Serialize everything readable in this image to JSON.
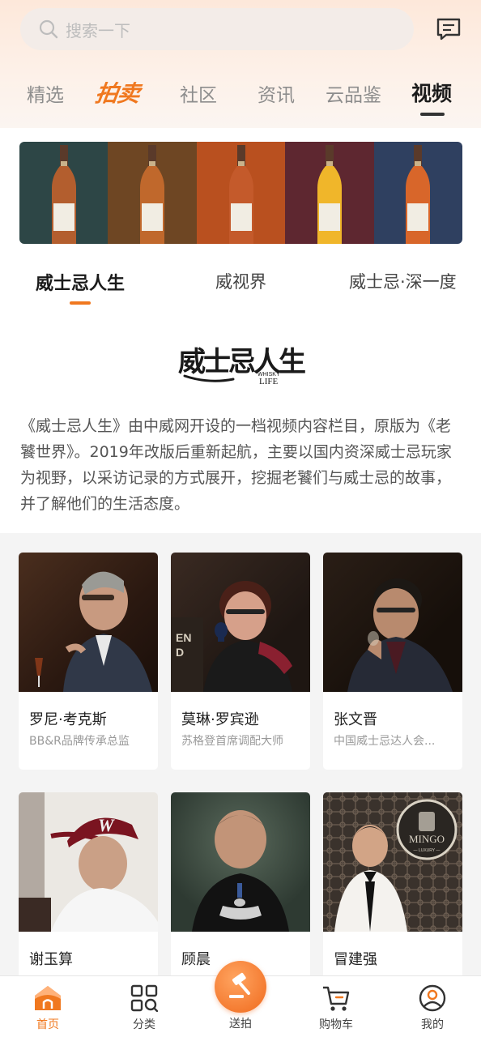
{
  "search": {
    "placeholder": "搜索一下"
  },
  "top_tabs": [
    {
      "label": "精选",
      "active": false
    },
    {
      "label": "拍卖",
      "active": false,
      "stylized": true
    },
    {
      "label": "社区",
      "active": false
    },
    {
      "label": "资讯",
      "active": false
    },
    {
      "label": "云品鉴",
      "active": false
    },
    {
      "label": "视频",
      "active": true
    }
  ],
  "sub_tabs": [
    {
      "label": "威士忌人生",
      "active": true
    },
    {
      "label": "威视界",
      "active": false
    },
    {
      "label": "威士忌·深一度",
      "active": false
    }
  ],
  "banner": {
    "panel_colors": [
      "#2d4646",
      "#6e4623",
      "#b9501f",
      "#5e2730",
      "#2f4060"
    ],
    "liquid_colors": [
      "#b35e2e",
      "#c0682c",
      "#c45a2b",
      "#f0b62a",
      "#d8662a"
    ]
  },
  "logo": {
    "calligraphy": "威士忌人生",
    "small": "WHISKY",
    "life": "LIFE"
  },
  "description": "《威士忌人生》由中威网开设的一档视频内容栏目，原版为《老饕世界》。2019年改版后重新起航，主要以国内资深威士忌玩家为视野，以采访记录的方式展开，挖掘老饕们与威士忌的故事，并了解他们的生活态度。",
  "persons": [
    {
      "name": "罗尼·考克斯",
      "title": "BB&R品牌传承总监"
    },
    {
      "name": "莫琳·罗宾逊",
      "title": "苏格登首席调配大师"
    },
    {
      "name": "张文晋",
      "title": "中国威士忌达人会..."
    },
    {
      "name": "谢玉算",
      "title": ""
    },
    {
      "name": "顾晨",
      "title": ""
    },
    {
      "name": "冒建强",
      "title": ""
    }
  ],
  "photo_texts": {
    "mingo": "MINGO",
    "mingo_sub": "— LUXURY —"
  },
  "bottom_nav": [
    {
      "label": "首页",
      "icon": "home-icon",
      "active": true
    },
    {
      "label": "分类",
      "icon": "category-icon",
      "active": false
    },
    {
      "label": "送拍",
      "icon": "gavel-icon",
      "active": false
    },
    {
      "label": "购物车",
      "icon": "cart-icon",
      "active": false
    },
    {
      "label": "我的",
      "icon": "profile-icon",
      "active": false
    }
  ],
  "colors": {
    "accent": "#f0781f",
    "active_text": "#1b1b1b",
    "inactive_text": "#8d8d8d"
  }
}
